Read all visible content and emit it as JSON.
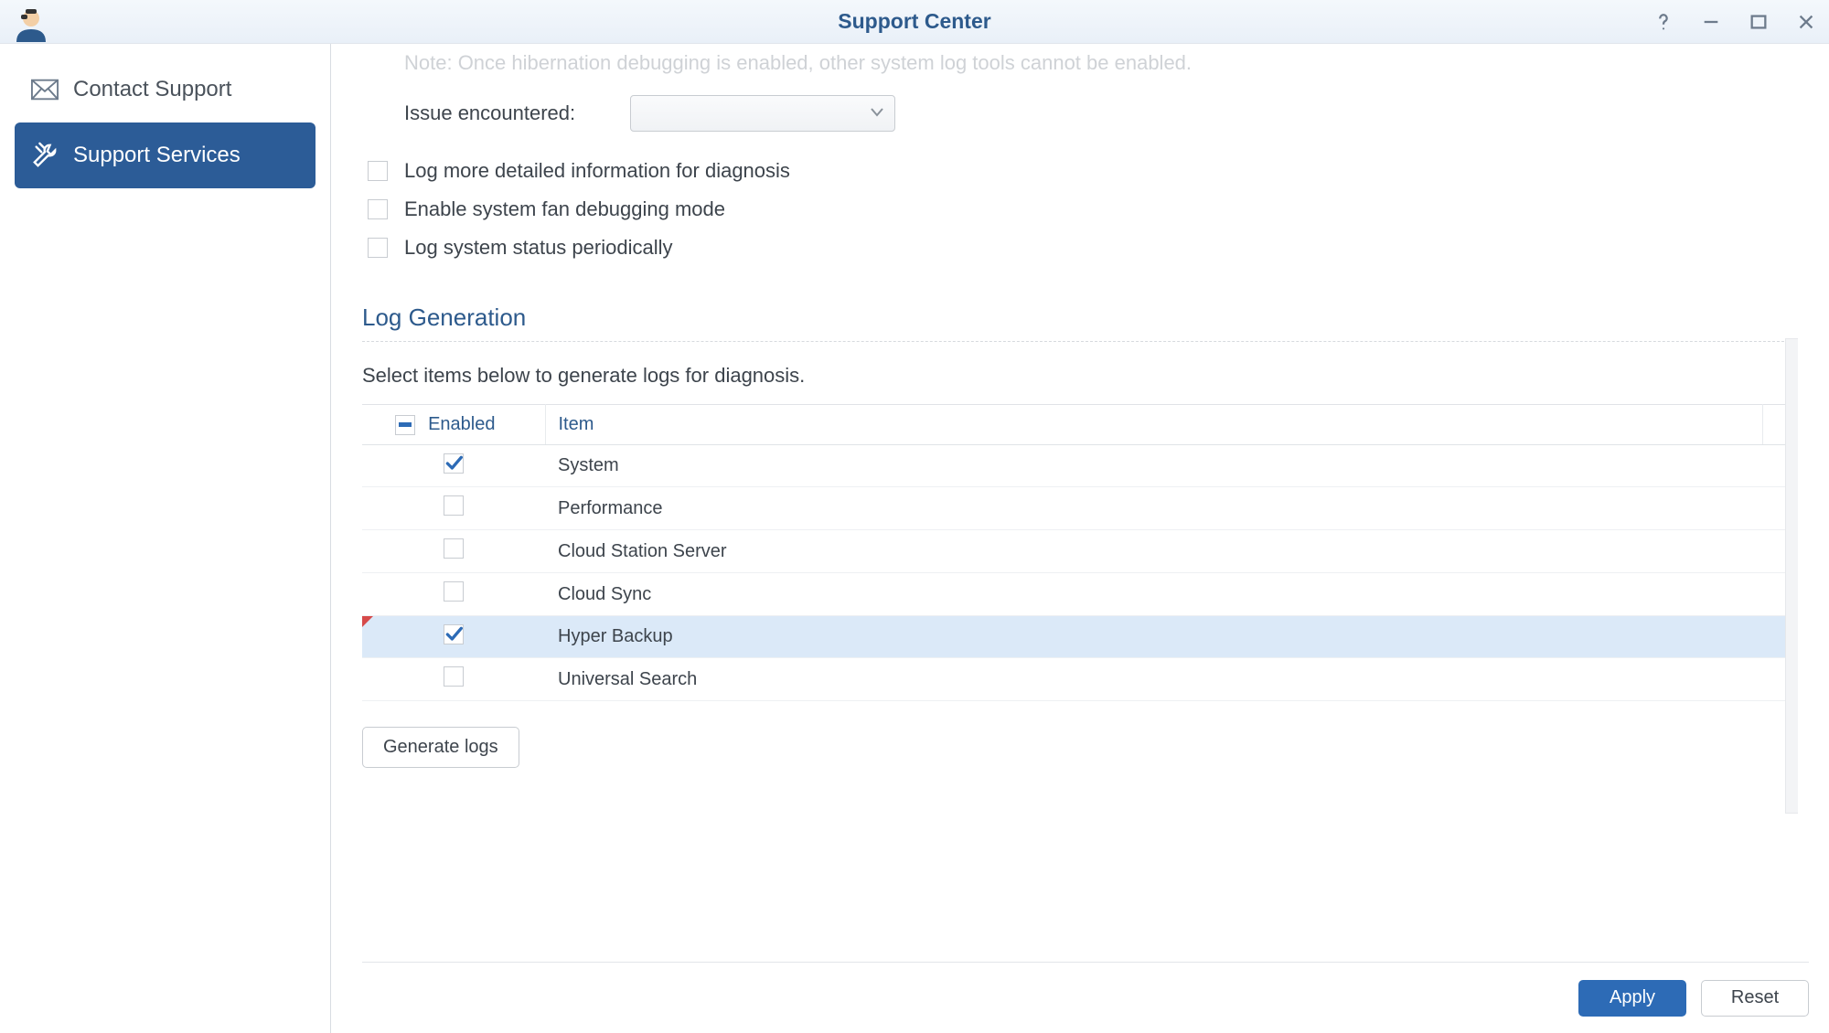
{
  "window": {
    "title": "Support Center"
  },
  "sidebar": {
    "items": [
      {
        "label": "Contact Support"
      },
      {
        "label": "Support Services"
      }
    ]
  },
  "hibernation": {
    "note": "Note: Once hibernation debugging is enabled, other system log tools cannot be enabled.",
    "issue_label": "Issue encountered:",
    "issue_value": "",
    "opt_detailed": "Log more detailed information for diagnosis",
    "opt_fan": "Enable system fan debugging mode",
    "opt_periodic": "Log system status periodically"
  },
  "loggen": {
    "title": "Log Generation",
    "desc": "Select items below to generate logs for diagnosis.",
    "col_enabled": "Enabled",
    "col_item": "Item",
    "rows": [
      {
        "label": "System",
        "checked": true,
        "selected": false,
        "dirty": false
      },
      {
        "label": "Performance",
        "checked": false,
        "selected": false,
        "dirty": false
      },
      {
        "label": "Cloud Station Server",
        "checked": false,
        "selected": false,
        "dirty": false
      },
      {
        "label": "Cloud Sync",
        "checked": false,
        "selected": false,
        "dirty": false
      },
      {
        "label": "Hyper Backup",
        "checked": true,
        "selected": true,
        "dirty": true
      },
      {
        "label": "Universal Search",
        "checked": false,
        "selected": false,
        "dirty": false
      }
    ],
    "generate_label": "Generate logs"
  },
  "footer": {
    "apply": "Apply",
    "reset": "Reset"
  }
}
